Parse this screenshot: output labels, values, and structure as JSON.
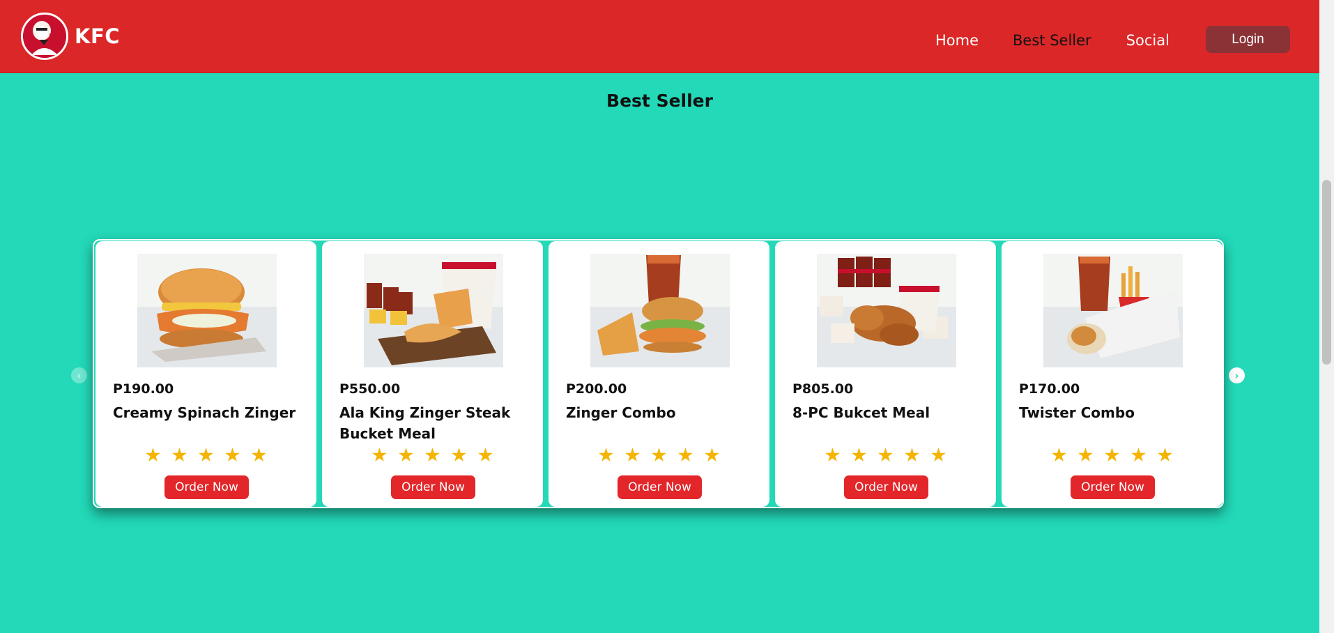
{
  "brand": {
    "name": "KFC",
    "logo_text": "KFC"
  },
  "nav": {
    "home": "Home",
    "best_seller": "Best Seller",
    "social": "Social",
    "login": "Login"
  },
  "section": {
    "title": "Best Seller"
  },
  "products": [
    {
      "price": "P190.00",
      "name": "Creamy Spinach Zinger",
      "rating": 5,
      "button": "Order Now"
    },
    {
      "price": "P550.00",
      "name": "Ala King Zinger Steak Bucket Meal",
      "rating": 5,
      "button": "Order Now"
    },
    {
      "price": "P200.00",
      "name": "Zinger Combo",
      "rating": 5,
      "button": "Order Now"
    },
    {
      "price": "P805.00",
      "name": "8-PC Bukcet Meal",
      "rating": 5,
      "button": "Order Now"
    },
    {
      "price": "P170.00",
      "name": "Twister Combo",
      "rating": 5,
      "button": "Order Now"
    }
  ],
  "colors": {
    "header": "#db2727",
    "background": "#23d9b8",
    "login_button": "#8a3236",
    "order_button": "#e3262a",
    "star": "#f4b400"
  },
  "icons": {
    "prev": "chevron-left-icon",
    "next": "chevron-right-icon",
    "rating": "star-icon"
  }
}
